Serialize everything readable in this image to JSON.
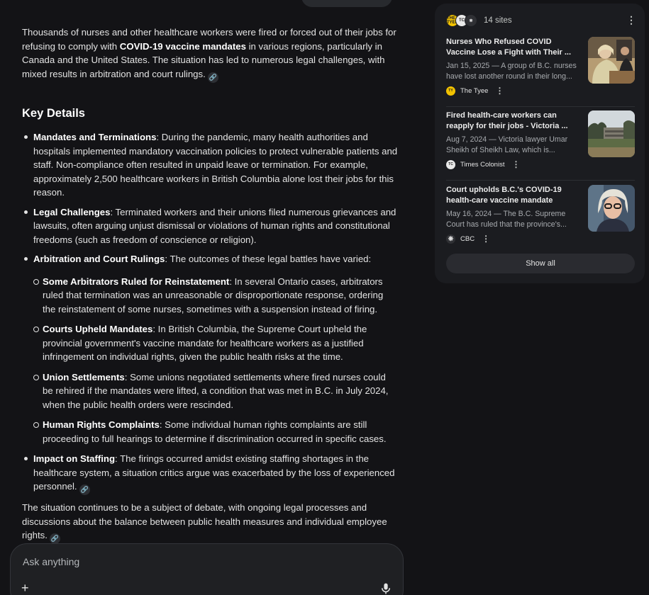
{
  "answer": {
    "intro": {
      "pre": "Thousands of nurses and other healthcare workers were fired or forced out of their jobs for refusing to comply with ",
      "bold": "COVID-19 vaccine mandates",
      "post": " in various regions, particularly in Canada and the United States. The situation has led to numerous legal challenges, with mixed results in arbitration and court rulings."
    },
    "heading": "Key Details",
    "points": [
      {
        "title": "Mandates and Terminations",
        "text": ": During the pandemic, many health authorities and hospitals implemented mandatory vaccination policies to protect vulnerable patients and staff. Non-compliance often resulted in unpaid leave or termination. For example, approximately 2,500 healthcare workers in British Columbia alone lost their jobs for this reason."
      },
      {
        "title": "Legal Challenges",
        "text": ": Terminated workers and their unions filed numerous grievances and lawsuits, often arguing unjust dismissal or violations of human rights and constitutional freedoms (such as freedom of conscience or religion)."
      },
      {
        "title": "Arbitration and Court Rulings",
        "text": ": The outcomes of these legal battles have varied:"
      },
      {
        "title": "Impact on Staffing",
        "text": ": The firings occurred amidst existing staffing shortages in the healthcare system, a situation critics argue was exacerbated by the loss of experienced personnel."
      }
    ],
    "subpoints": [
      {
        "title": "Some Arbitrators Ruled for Reinstatement",
        "text": ": In several Ontario cases, arbitrators ruled that termination was an unreasonable or disproportionate response, ordering the reinstatement of some nurses, sometimes with a suspension instead of firing."
      },
      {
        "title": "Courts Upheld Mandates",
        "text": ": In British Columbia, the Supreme Court upheld the provincial government's vaccine mandate for healthcare workers as a justified infringement on individual rights, given the public health risks at the time."
      },
      {
        "title": "Union Settlements",
        "text": ": Some unions negotiated settlements where fired nurses could be rehired if the mandates were lifted, a condition that was met in B.C. in July 2024, when the public health orders were rescinded."
      },
      {
        "title": "Human Rights Complaints",
        "text": ": Some individual human rights complaints are still proceeding to full hearings to determine if discrimination occurred in specific cases."
      }
    ],
    "closing": "The situation continues to be a subject of debate, with ongoing legal processes and discussions about the balance between public health measures and individual employee rights."
  },
  "ask": {
    "placeholder": "Ask anything",
    "plus": "+"
  },
  "sources": {
    "count_label": "14 sites",
    "favicon_labels": [
      "THE TYEE",
      "TC",
      "CBC"
    ],
    "cards": [
      {
        "title": "Nurses Who Refused COVID Vaccine Lose a Fight with Their ...",
        "snippet": "Jan 15, 2025 — A group of B.C. nurses have lost another round in their long...",
        "source": "The Tyee",
        "favicon": "THE TYEE"
      },
      {
        "title": "Fired health-care workers can reapply for their jobs - Victoria ...",
        "snippet": "Aug 7, 2024 — Victoria lawyer Umar Sheikh of Sheikh Law, which is...",
        "source": "Times Colonist",
        "favicon": "TC"
      },
      {
        "title": "Court upholds B.C.'s COVID-19 health-care vaccine mandate",
        "snippet": "May 16, 2024 — The B.C. Supreme Court has ruled that the province's...",
        "source": "CBC",
        "favicon": "CBC"
      }
    ],
    "show_all": "Show all"
  },
  "colors": {
    "background": "#131316",
    "panel": "#1b1c20",
    "tyee_yellow": "#f2c200"
  },
  "icons": [
    "link-icon",
    "more-vert-icon",
    "plus-icon",
    "mic-icon"
  ]
}
